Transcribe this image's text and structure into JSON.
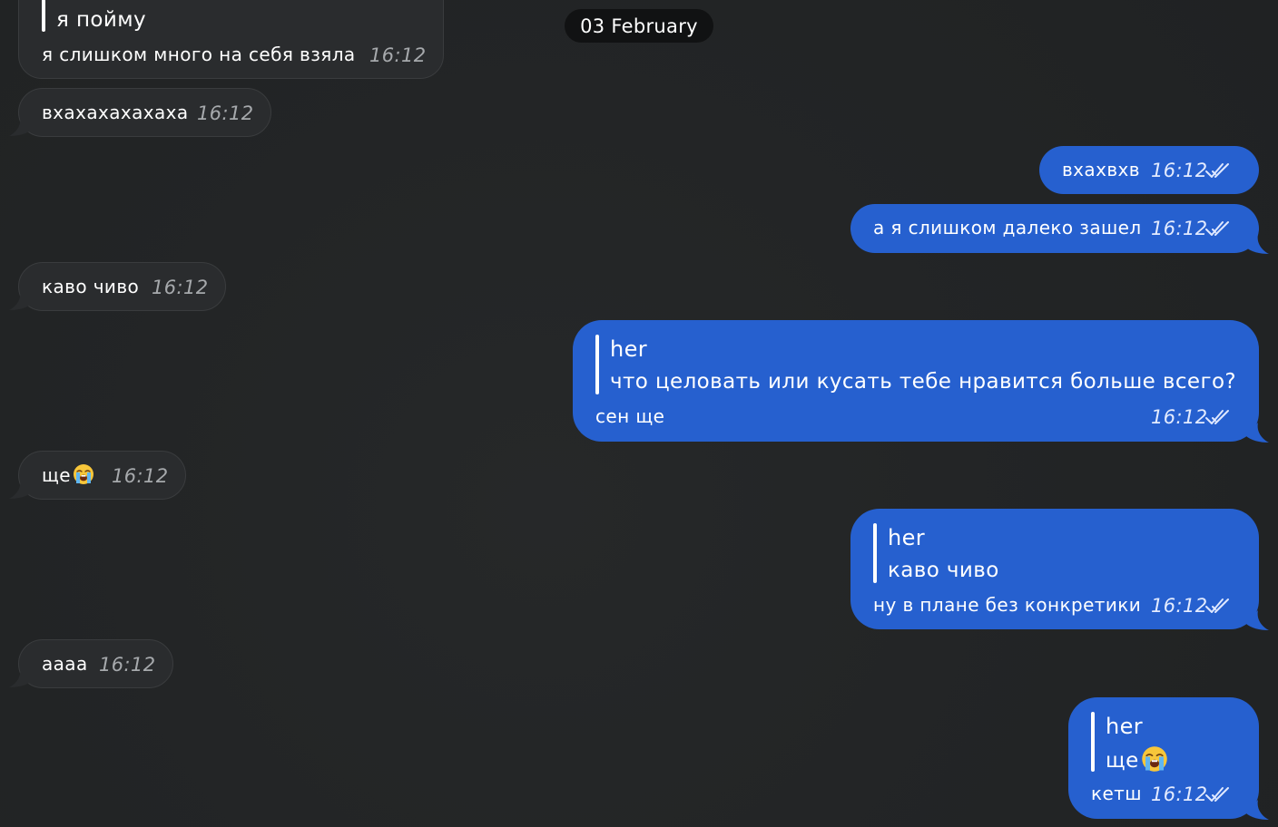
{
  "date_separator": "03 February",
  "messages": [
    {
      "side": "in",
      "quote_text": "я пойму",
      "text": "я слишком много на себя взяла",
      "time": "16:12"
    },
    {
      "side": "in",
      "text": "вхахахахахаха",
      "time": "16:12"
    },
    {
      "side": "out",
      "text": "вхахвхв",
      "time": "16:12",
      "status": "read"
    },
    {
      "side": "out",
      "text": "а я слишком далеко зашел",
      "time": "16:12",
      "status": "read"
    },
    {
      "side": "in",
      "text": "каво чиво",
      "time": "16:12"
    },
    {
      "side": "out",
      "quote_author": "her",
      "quote_text": "что целовать или кусать тебе нравится больше всего?",
      "text": "сен ще",
      "time": "16:12",
      "status": "read"
    },
    {
      "side": "in",
      "text": "ще",
      "emoji": "crying-face",
      "time": "16:12"
    },
    {
      "side": "out",
      "quote_author": "her",
      "quote_text": "каво чиво",
      "text": "ну в плане без конкретики",
      "time": "16:12",
      "status": "read"
    },
    {
      "side": "in",
      "text": "аааа",
      "time": "16:12"
    },
    {
      "side": "out",
      "quote_author": "her",
      "quote_text": "ще",
      "quote_emoji": "crying-face",
      "text": "кетш",
      "time": "16:12",
      "status": "read"
    }
  ],
  "colors": {
    "background": "#222426",
    "incoming_bubble": "#2a2c2e",
    "outgoing_bubble": "#2660cf",
    "date_pill": "#111213"
  }
}
